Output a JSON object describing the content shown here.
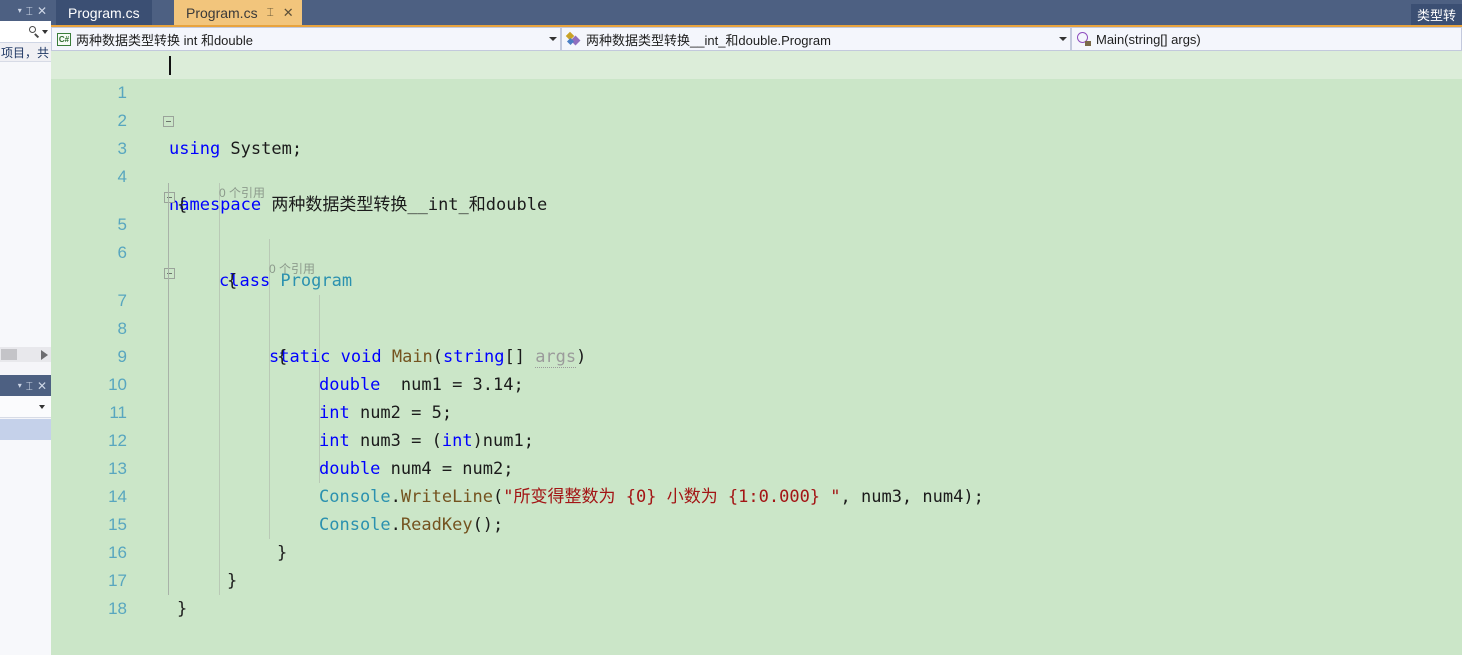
{
  "window": {
    "tabs": [
      {
        "label": "Program.cs",
        "active": false,
        "pin": "",
        "close": ""
      },
      {
        "label": "Program.cs",
        "active": true,
        "pin": "⌶",
        "close": "✕"
      }
    ],
    "right_tab_label": "类型转"
  },
  "left_panels": {
    "top_panel": {
      "caret": "▾",
      "pin": "⌶",
      "close": "✕",
      "search_placeholder": "",
      "count_text": "项目，共"
    },
    "bottom_panel": {
      "caret": "▾",
      "pin": "⌶",
      "close": "✕",
      "dropdown_caret": "▾"
    }
  },
  "navbar": {
    "project_selector": "两种数据类型转换  int 和double",
    "type_selector": "两种数据类型转换__int_和double.Program",
    "member_selector": "Main(string[] args)",
    "dropdown_glyph": "▾"
  },
  "editor": {
    "line_numbers": [
      "1",
      "2",
      "3",
      "4",
      "5",
      "6",
      "7",
      "8",
      "9",
      "10",
      "11",
      "12",
      "13",
      "14",
      "15",
      "16",
      "17",
      "18"
    ],
    "annotations": {
      "class_refs": "0 个引用",
      "method_refs": "0 个引用"
    },
    "lines": {
      "l1_using": "using",
      "l1_system": " System;",
      "l3_namespace": "namespace",
      "l3_name": " 两种数据类型转换__int_和double",
      "l4_brace": "{",
      "l5_class": "class",
      "l5_name": " Program",
      "l6_brace": "{",
      "l7_static": "static",
      "l7_void": " void",
      "l7_main": " Main",
      "l7_paren": "(",
      "l7_string": "string",
      "l7_brackets": "[] ",
      "l7_args": "args",
      "l7_close": ")",
      "l8_brace": "{",
      "l9_double": "double",
      "l9_rest": "  num1 = 3.14;",
      "l10_int": "int",
      "l10_rest": " num2 = 5;",
      "l11_int": "int",
      "l11_rest1": " num3 = (",
      "l11_int2": "int",
      "l11_rest2": ")num1;",
      "l12_double": "double",
      "l12_rest": " num4 = num2;",
      "l13_console": "Console",
      "l13_dot": ".",
      "l13_writeline": "WriteLine",
      "l13_open": "(",
      "l13_str": "\"所变得整数为 {0} 小数为 {1:0.000} \"",
      "l13_args": ", num3, num4);",
      "l14_console": "Console",
      "l14_dot": ".",
      "l14_readkey": "ReadKey",
      "l14_rest": "();",
      "l15_brace": "}",
      "l16_brace": "}",
      "l17_brace": "}"
    }
  },
  "colors": {
    "editor_background": "#cbe6c8",
    "current_line": "#dcedd9",
    "line_number": "#58a6bf",
    "keyword": "#0000ff",
    "type": "#2b91af",
    "string": "#a31515",
    "method": "#74531f",
    "tab_active": "#f2c57c",
    "chrome": "#4d6082"
  }
}
